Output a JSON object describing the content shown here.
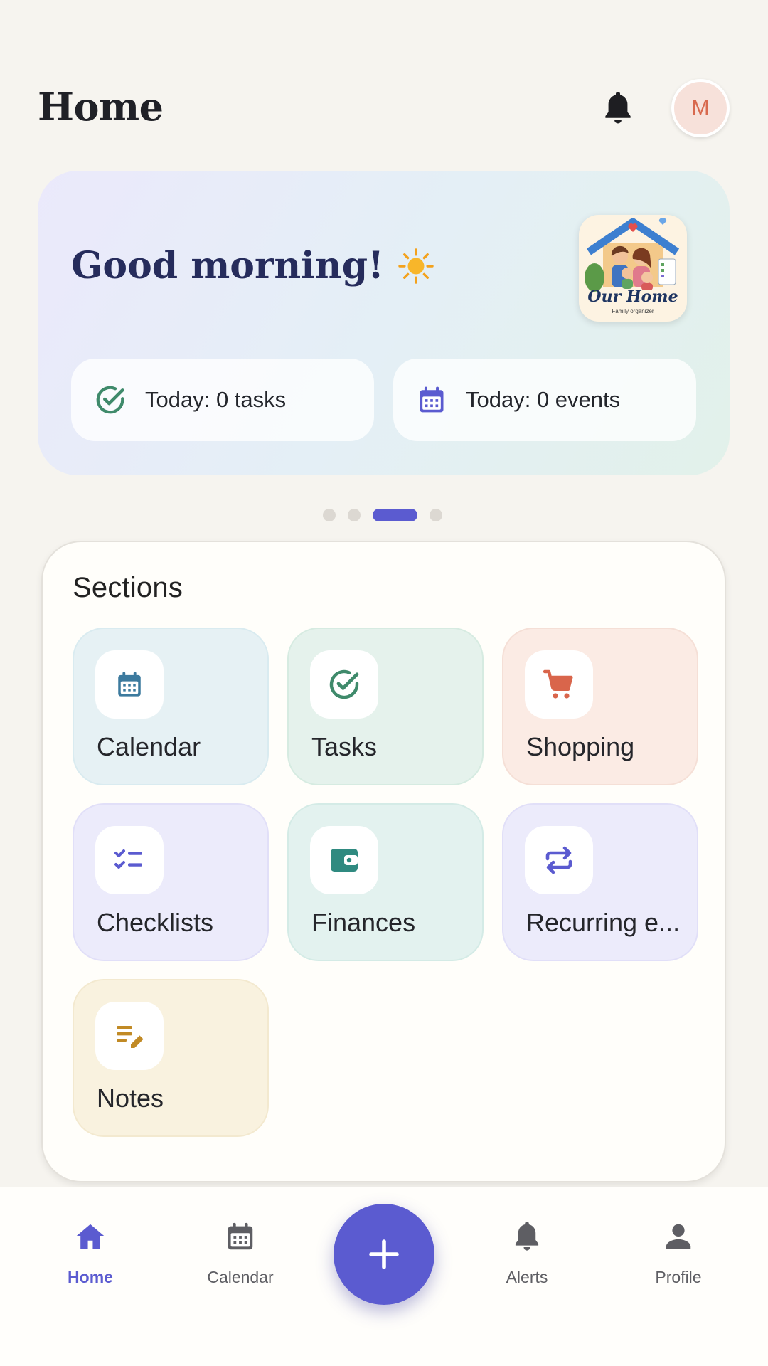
{
  "header": {
    "title": "Home",
    "avatar_initial": "M"
  },
  "hero": {
    "greeting": "Good morning!",
    "logo_title": "Our Home",
    "logo_subtitle": "Family organizer",
    "tasks_stat": "Today: 0 tasks",
    "events_stat": "Today: 0 events"
  },
  "pager": {
    "count": 4,
    "active_index": 2
  },
  "sections": {
    "title": "Sections",
    "items": [
      {
        "label": "Calendar",
        "icon": "calendar-icon",
        "color": "#3c7a9e"
      },
      {
        "label": "Tasks",
        "icon": "check-circle-icon",
        "color": "#3f8a6b"
      },
      {
        "label": "Shopping",
        "icon": "cart-icon",
        "color": "#d9654b"
      },
      {
        "label": "Checklists",
        "icon": "checklist-icon",
        "color": "#5b5bd0"
      },
      {
        "label": "Finances",
        "icon": "wallet-icon",
        "color": "#2f8a80"
      },
      {
        "label": "Recurring e...",
        "icon": "repeat-icon",
        "color": "#5b5bd0"
      },
      {
        "label": "Notes",
        "icon": "notes-edit-icon",
        "color": "#c18a25"
      }
    ]
  },
  "nav": {
    "items": [
      {
        "label": "Home",
        "icon": "home-icon",
        "active": true
      },
      {
        "label": "Calendar",
        "icon": "calendar-icon",
        "active": false
      },
      {
        "label": "Alerts",
        "icon": "bell-icon",
        "active": false
      },
      {
        "label": "Profile",
        "icon": "person-icon",
        "active": false
      }
    ],
    "fab_icon": "plus-icon"
  },
  "colors": {
    "accent": "#5b5bd0",
    "background": "#f6f4ef",
    "greeting_text": "#262c5c"
  }
}
